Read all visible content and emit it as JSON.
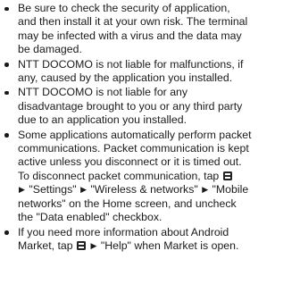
{
  "notes": [
    {
      "lines": [
        [
          "Be sure to check the security of application,"
        ],
        [
          "and then install it at your own risk. The terminal"
        ],
        [
          "may be infected with a virus and the data may"
        ],
        [
          "be damaged."
        ]
      ]
    },
    {
      "lines": [
        [
          "NTT DOCOMO is not liable for malfunctions, if"
        ],
        [
          "any, caused by the application you installed."
        ]
      ]
    },
    {
      "lines": [
        [
          "NTT DOCOMO is not liable for any"
        ],
        [
          "disadvantage brought to you or any third party"
        ],
        [
          "due to an application you installed."
        ]
      ]
    },
    {
      "lines": [
        [
          "Some applications automatically perform packet"
        ],
        [
          "communications. Packet communication is kept"
        ],
        [
          "active unless you disconnect or it is timed out."
        ],
        [
          "To disconnect packet communication, tap ",
          "{menu}"
        ],
        [
          "{arrow}",
          " \"Settings\" ",
          "{arrow}",
          " \"Wireless & networks\" ",
          "{arrow}",
          " \"Mobile"
        ],
        [
          "networks\" on the Home screen, and uncheck"
        ],
        [
          "the \"Data enabled\" checkbox."
        ]
      ]
    },
    {
      "lines": [
        [
          "If you need more information about Android"
        ],
        [
          "Market, tap ",
          "{menu}",
          " ",
          "{arrow}",
          " \"Help\" when Market is open."
        ]
      ]
    }
  ],
  "icons": {
    "menu": "menu-key-icon",
    "arrow": "▶"
  }
}
